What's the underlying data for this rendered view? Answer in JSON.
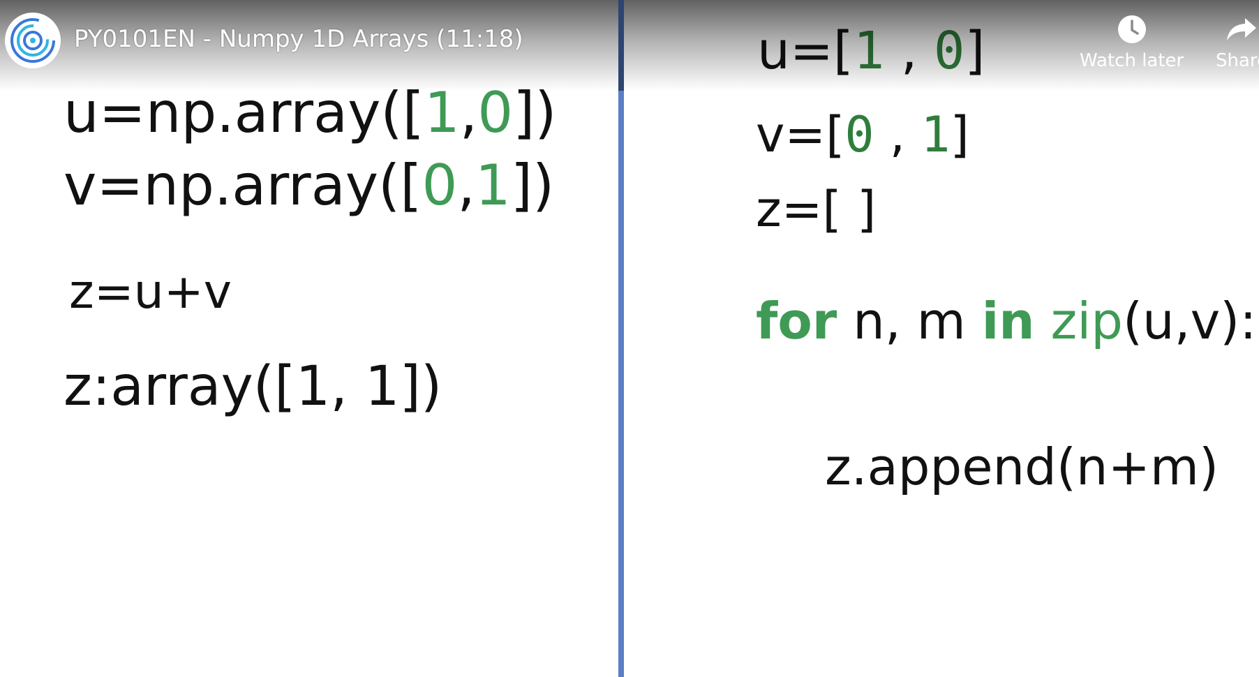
{
  "header": {
    "video_title": "PY0101EN - Numpy 1D Arrays (11:18)",
    "channel_logo_icon": "channel-logo-icon",
    "watch_later_label": "Watch later",
    "watch_later_icon": "clock-icon",
    "share_label": "Share",
    "share_icon": "share-arrow-icon"
  },
  "left_panel": {
    "line_u": {
      "prefix": "u=np.array([",
      "a": "1",
      "sep": ",",
      "b": "0",
      "suffix": "])"
    },
    "line_v": {
      "prefix": "v=np.array([",
      "a": "0",
      "sep": ",",
      "b": "1",
      "suffix": "])"
    },
    "line_z": "z=u+v",
    "line_result": "z:array([1, 1])"
  },
  "right_panel": {
    "line_u": {
      "prefix": "u=[",
      "a": "1",
      "sep": " , ",
      "b": "0",
      "suffix": "]"
    },
    "line_v": {
      "prefix": "v=[",
      "a": "0",
      "sep": " , ",
      "b": "1",
      "suffix": "]"
    },
    "line_z": "z=[ ]",
    "line_for": {
      "kw_for": "for",
      "vars": " n, m ",
      "kw_in": "in",
      "space": " ",
      "fn_zip": "zip",
      "args": "(u,v):"
    },
    "line_append": "z.append(n+m)"
  },
  "colors": {
    "keyword_green": "#3f9a55",
    "number_green": "#2f7d3c",
    "divider_blue": "#5b7fc4",
    "text": "#111111"
  }
}
